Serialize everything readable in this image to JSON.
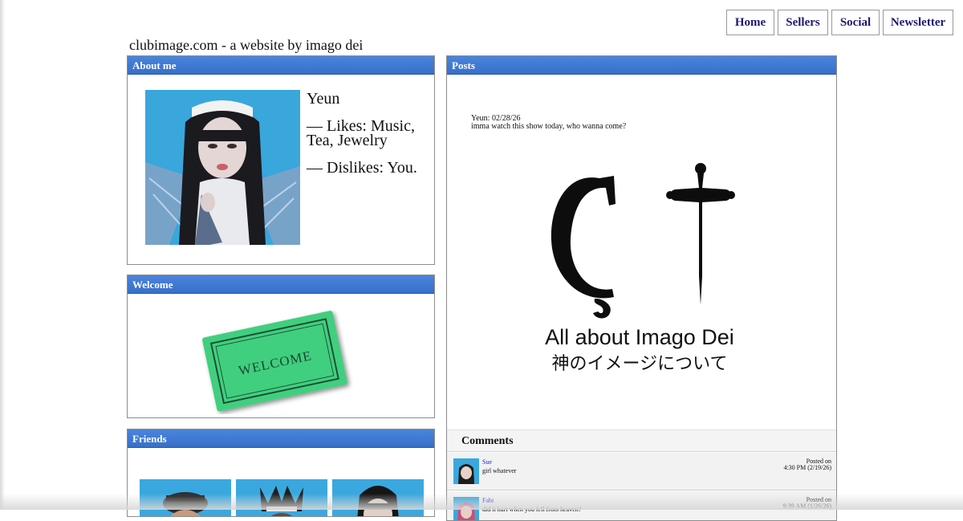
{
  "nav": {
    "home": "Home",
    "sellers": "Sellers",
    "social": "Social",
    "newsletter": "Newsletter"
  },
  "site_title": "clubimage.com - a website by imago dei",
  "about": {
    "header": "About me",
    "name": "Yeun",
    "likes": "— Likes: Music, Tea, Jewelry",
    "dislikes": "— Dislikes: You."
  },
  "welcome": {
    "header": "Welcome",
    "mat_text": "WELCOME"
  },
  "friends": {
    "header": "Friends"
  },
  "posts": {
    "header": "Posts",
    "meta": "Yeun: 02/28/26",
    "body": "imma watch this show today, who wanna come?",
    "graphic": {
      "title": "All about Imago Dei",
      "subtitle": "神のイメージについて"
    }
  },
  "comments": {
    "header": "Comments",
    "items": [
      {
        "name": "Sue",
        "text": "girl whatever",
        "posted_label": "Posted on",
        "posted_time": "4:30 PM (2/19/26)"
      },
      {
        "name": "Fabi",
        "text": "did it hurt when you fell from heaven?",
        "posted_label": "Posted on",
        "posted_time": "9:39 AM (1/26/26)"
      }
    ]
  },
  "colors": {
    "panel_header": "#3c77d3",
    "nav_text": "#1d1970",
    "welcome_mat": "#3fcf7e"
  }
}
